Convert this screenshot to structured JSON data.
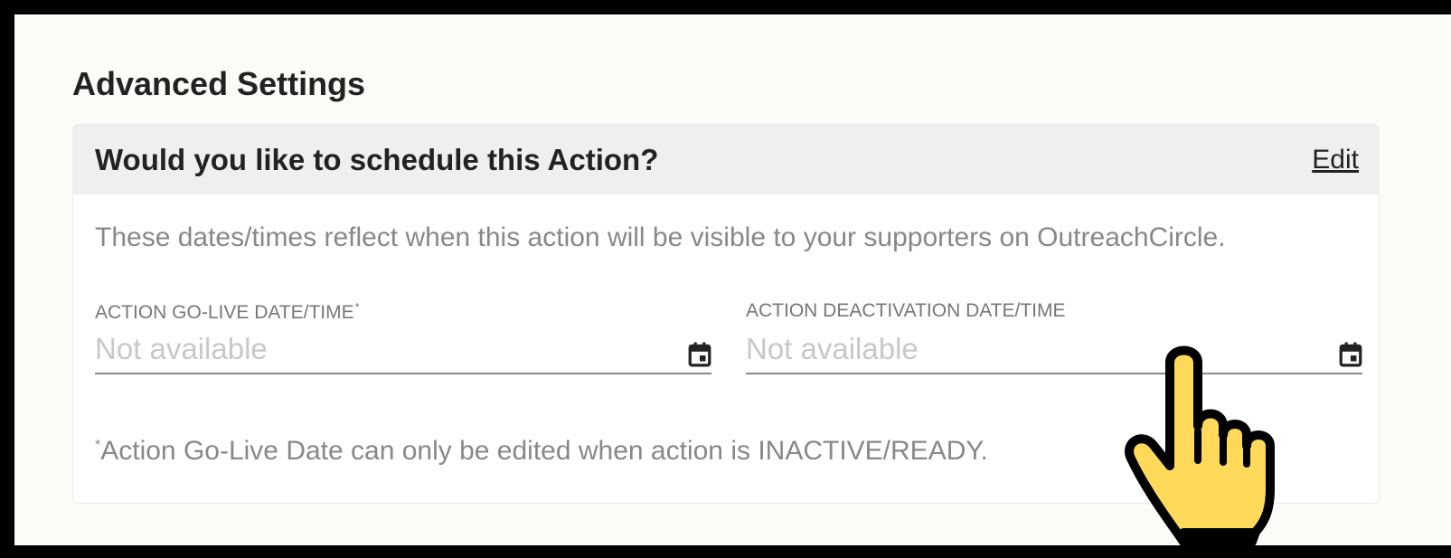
{
  "section": {
    "title": "Advanced Settings"
  },
  "schedule_card": {
    "title": "Would you like to schedule this Action?",
    "edit_label": "Edit",
    "description": "These dates/times reflect when this action will be visible to your supporters on OutreachCircle.",
    "fields": {
      "go_live": {
        "label": "ACTION GO-LIVE DATE/TIME",
        "required_marker": "*",
        "placeholder": "Not available",
        "icon": "calendar-icon"
      },
      "deactivation": {
        "label": "ACTION DEACTIVATION DATE/TIME",
        "placeholder": "Not available",
        "icon": "calendar-icon"
      }
    },
    "footnote_marker": "*",
    "footnote": "Action Go-Live Date can only be edited when action is INACTIVE/READY."
  },
  "cursor": {
    "icon": "hand-pointer-icon",
    "color": "#FFD95A"
  }
}
